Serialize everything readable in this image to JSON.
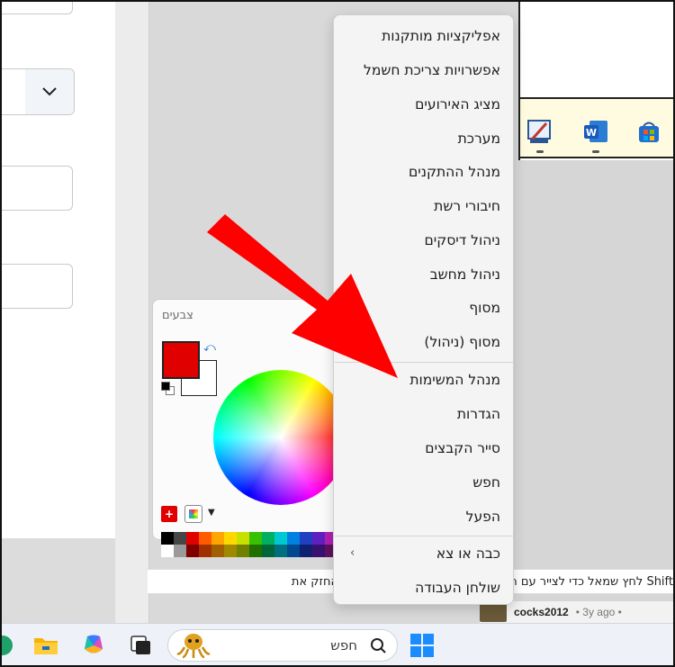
{
  "context_menu": {
    "items": [
      {
        "label": "אפליקציות מותקנות"
      },
      {
        "label": "אפשרויות צריכת חשמל"
      },
      {
        "label": "מציג האירועים"
      },
      {
        "label": "מערכת"
      },
      {
        "label": "מנהל ההתקנים"
      },
      {
        "label": "חיבורי רשת"
      },
      {
        "label": "ניהול דיסקים"
      },
      {
        "label": "ניהול מחשב"
      },
      {
        "label": "מסוף"
      },
      {
        "label": "מסוף (ניהול)"
      },
      {
        "label": "מנהל המשימות"
      },
      {
        "label": "הגדרות"
      },
      {
        "label": "סייר הקבצים"
      },
      {
        "label": "חפש"
      },
      {
        "label": "הפעל"
      },
      {
        "label": "כבה או צא"
      },
      {
        "label": "שולחן העבודה"
      }
    ]
  },
  "colors_panel": {
    "title": "צבעים",
    "primary_color": "#e00000",
    "secondary_color": "#ffffff"
  },
  "hint_bar": {
    "text": "Shift לחץ שמאל כדי לצייר עם הצבע הראשי. השתמש בצבע משני. החזק את"
  },
  "comment": {
    "user": "cocks2012",
    "meta": "• 3y ago •"
  },
  "taskbar": {
    "search_label": "חפש"
  },
  "annotation": {
    "arrow_color": "#ff0000"
  }
}
